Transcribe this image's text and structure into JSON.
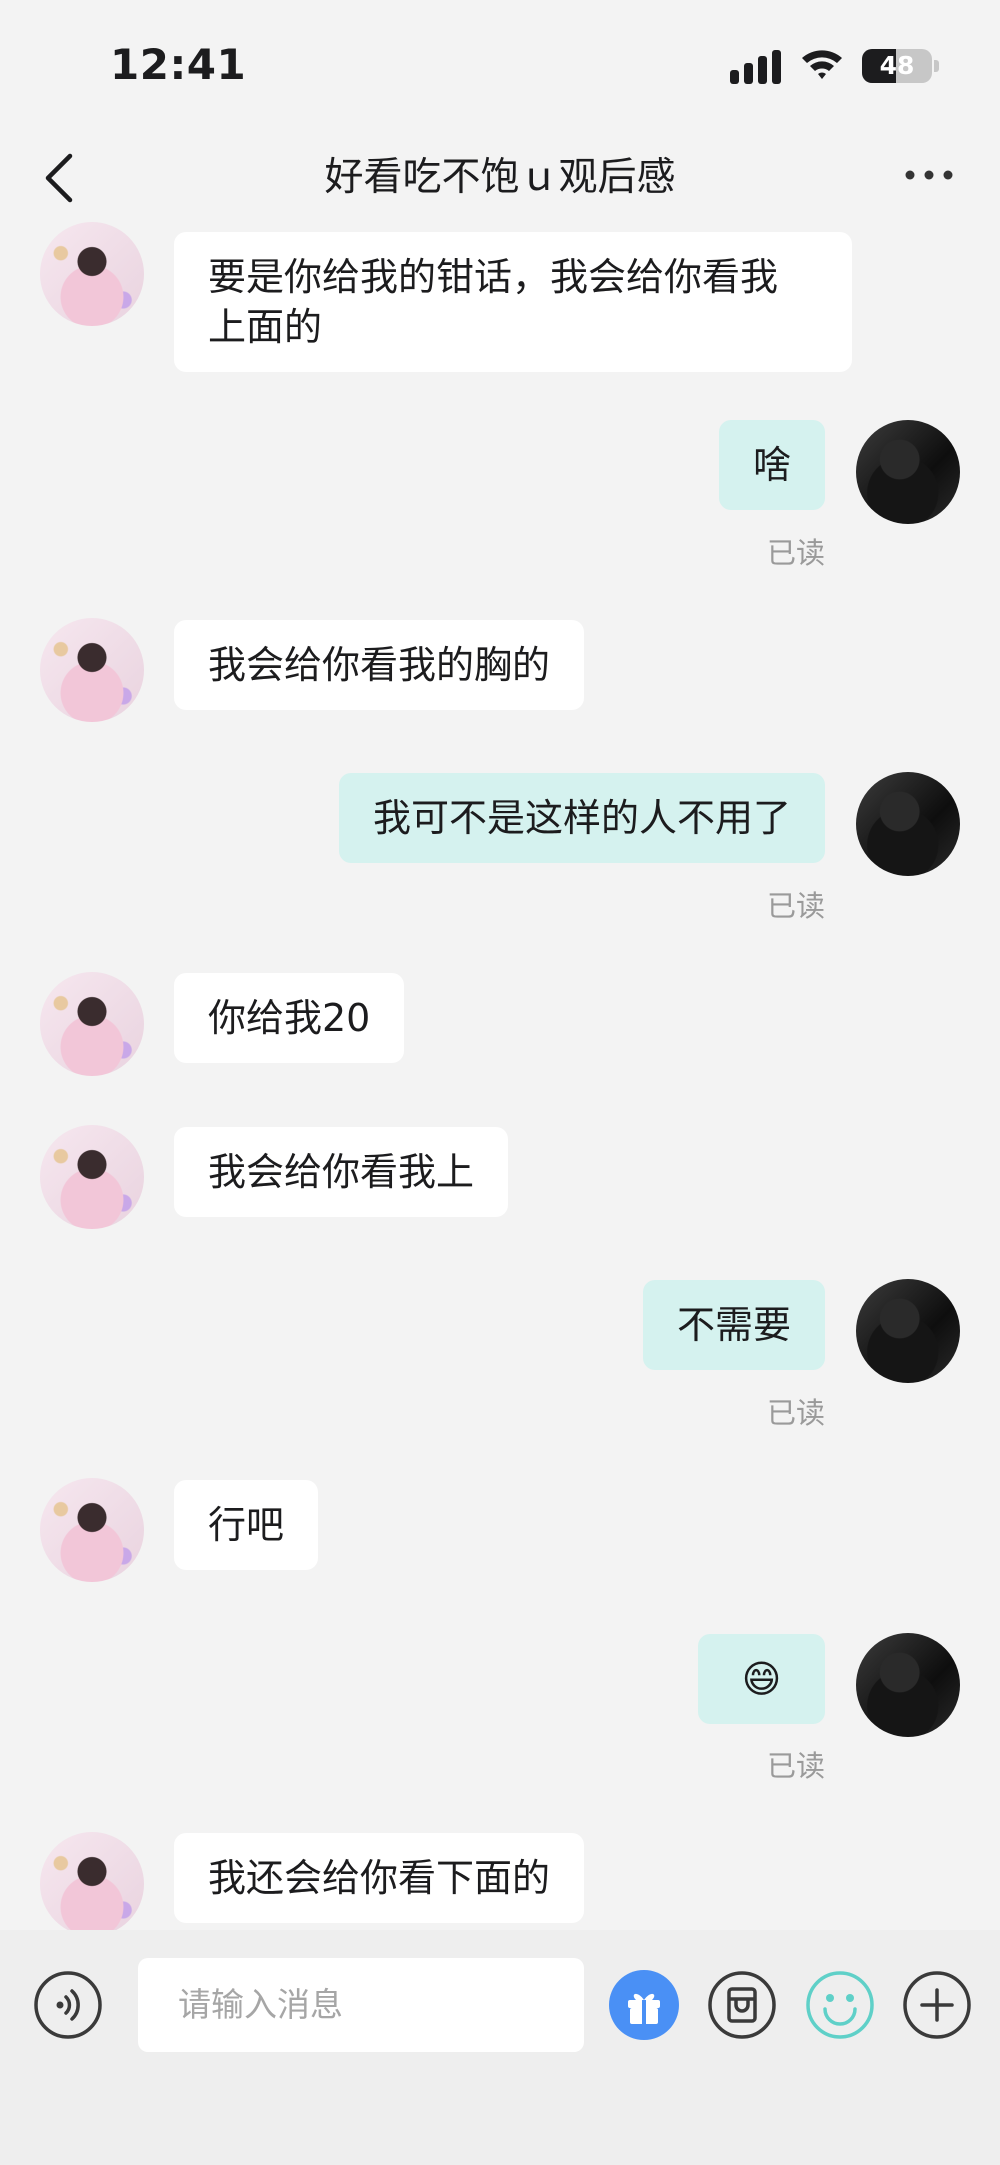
{
  "status_bar": {
    "time": "12:41",
    "battery": "48",
    "battery_level": 0.48
  },
  "nav": {
    "title": "好看吃不饱ｕ观后感"
  },
  "messages": [
    {
      "side": "left",
      "text": "要是你给我的钳话，我会给你看我\n上面的"
    },
    {
      "side": "right",
      "text": "啥",
      "read": "已读"
    },
    {
      "side": "left",
      "text": "我会给你看我的胸的"
    },
    {
      "side": "right",
      "text": "我可不是这样的人不用了",
      "read": "已读"
    },
    {
      "side": "left",
      "text": "你给我20"
    },
    {
      "side": "left",
      "text": "我会给你看我上"
    },
    {
      "side": "right",
      "text": "不需要",
      "read": "已读"
    },
    {
      "side": "left",
      "text": "行吧"
    },
    {
      "side": "right",
      "text": "😄",
      "read": "已读"
    },
    {
      "side": "left",
      "text": "我还会给你看下面的"
    }
  ],
  "input": {
    "placeholder": "请输入消息"
  },
  "icons": {
    "voice": "voice-icon",
    "gift": "gift-icon",
    "bag": "bag-icon",
    "emoji": "emoji-icon",
    "plus": "plus-icon"
  },
  "colors": {
    "outgoing_bubble": "#d5f2ef",
    "accent": "#5fd0c8",
    "gift": "#4a90f5"
  }
}
